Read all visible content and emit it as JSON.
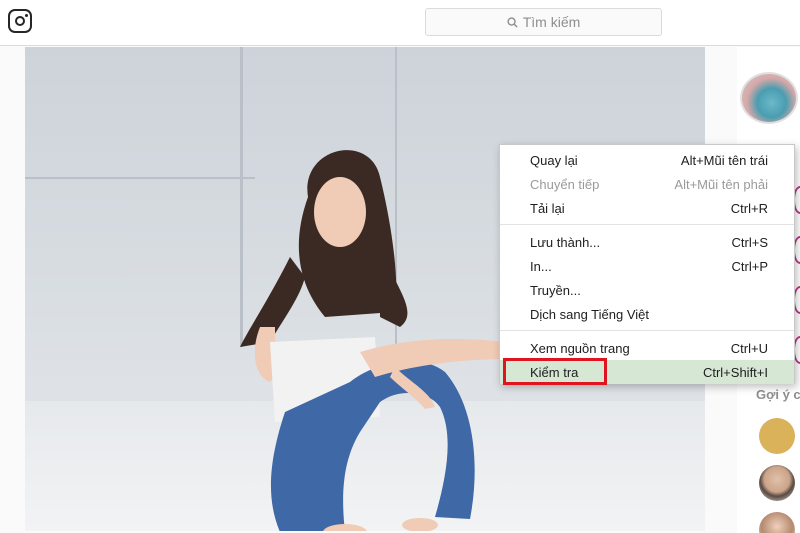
{
  "search": {
    "placeholder": "Tìm kiếm",
    "icon": "search-icon"
  },
  "sidebar": {
    "suggestions_label": "Gợi ý c"
  },
  "context_menu": {
    "items": [
      {
        "label": "Quay lại",
        "shortcut": "Alt+Mũi tên trái",
        "disabled": false
      },
      {
        "label": "Chuyển tiếp",
        "shortcut": "Alt+Mũi tên phải",
        "disabled": true
      },
      {
        "label": "Tải lại",
        "shortcut": "Ctrl+R",
        "disabled": false
      },
      {
        "label": "Lưu thành...",
        "shortcut": "Ctrl+S",
        "disabled": false
      },
      {
        "label": "In...",
        "shortcut": "Ctrl+P",
        "disabled": false
      },
      {
        "label": "Truyền...",
        "shortcut": "",
        "disabled": false
      },
      {
        "label": "Dịch sang Tiếng Việt",
        "shortcut": "",
        "disabled": false
      },
      {
        "label": "Xem nguồn trang",
        "shortcut": "Ctrl+U",
        "disabled": false
      },
      {
        "label": "Kiểm tra",
        "shortcut": "Ctrl+Shift+I",
        "disabled": false,
        "highlighted": true
      }
    ]
  },
  "colors": {
    "highlight": "#d6e8d4",
    "annotation_box": "#e0141e",
    "story_ring": "#c13584"
  }
}
